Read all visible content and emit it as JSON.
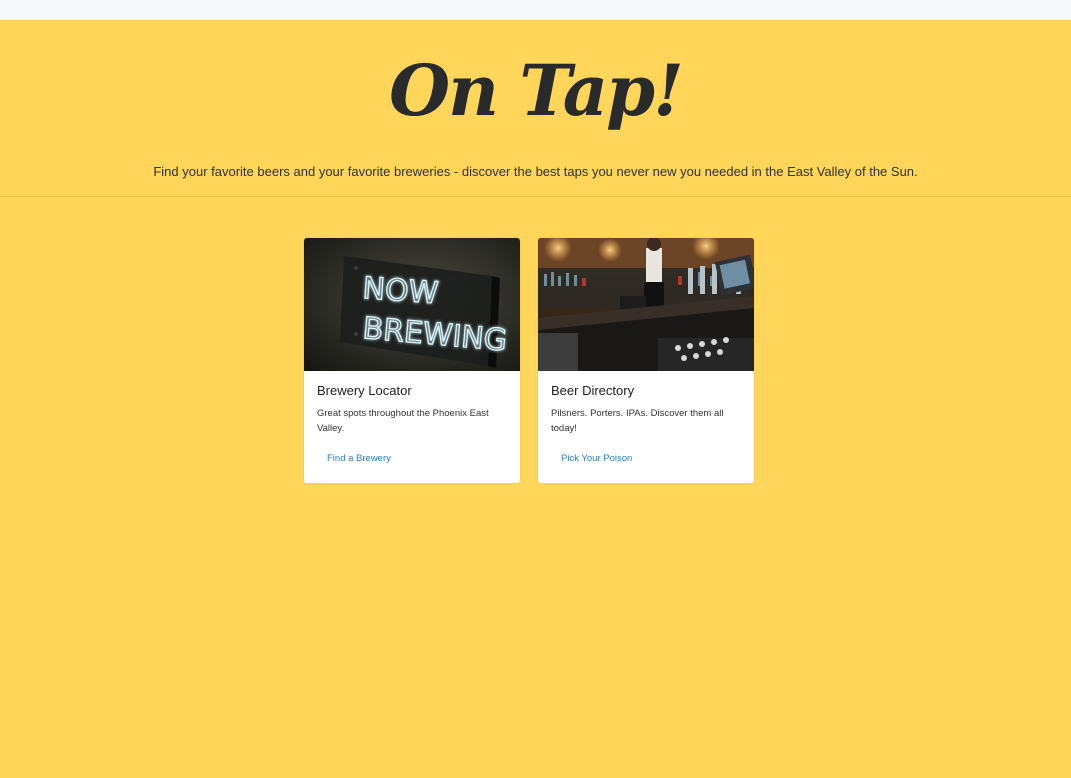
{
  "hero": {
    "title": "On Tap!",
    "subtitle": "Find your favorite beers and your favorite breweries - discover the best taps you never new you needed in the East Valley of the Sun."
  },
  "cards": [
    {
      "image_icon": "neon-sign-image",
      "image_text_line1": "NOW",
      "image_text_line2": "BREWING",
      "title": "Brewery Locator",
      "text": "Great spots throughout the Phoenix East Valley.",
      "link": "Find a Brewery"
    },
    {
      "image_icon": "bar-scene-image",
      "title": "Beer Directory",
      "text": "Pilsners. Porters. IPAs. Discover them all today!",
      "link": "Pick Your Poison"
    }
  ],
  "colors": {
    "background": "#ffd65a",
    "topbar": "#f7f8fa",
    "title": "#282a2c",
    "link": "#2b7ec9",
    "card": "#ffffff",
    "neon": "#bfefff"
  }
}
